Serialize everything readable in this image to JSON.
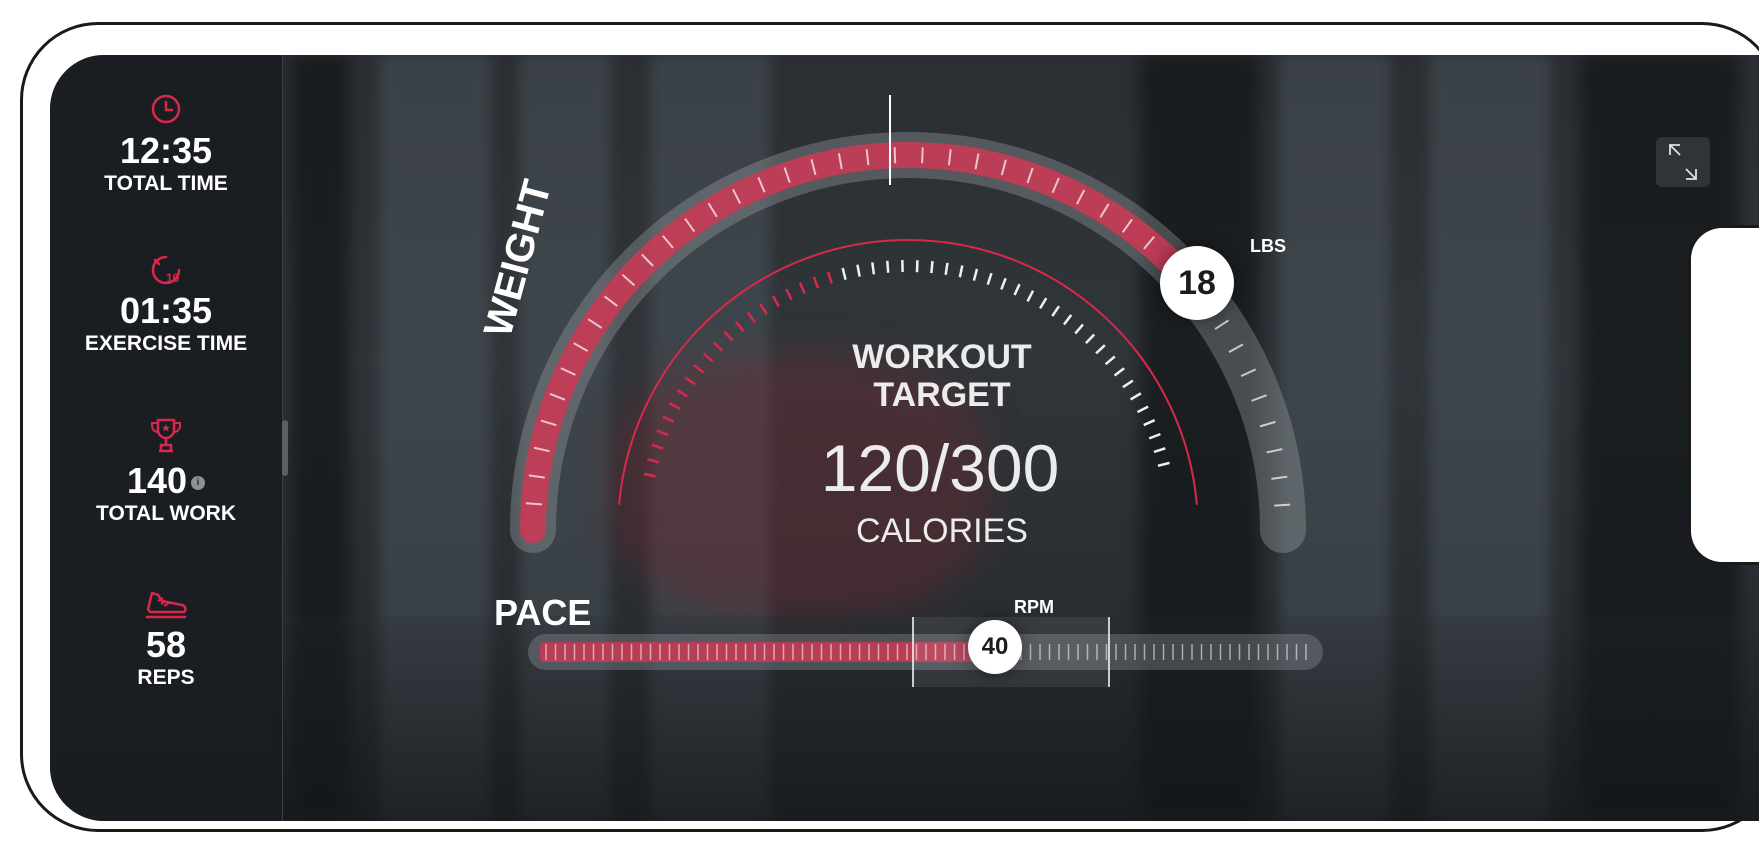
{
  "stats": {
    "total_time": {
      "value": "12:35",
      "label": "TOTAL TIME",
      "icon": "clock-icon"
    },
    "exercise_time": {
      "value": "01:35",
      "label": "EXERCISE TIME",
      "icon": "timer-10-icon"
    },
    "total_work": {
      "value": "140",
      "label": "TOTAL WORK",
      "icon": "trophy-icon",
      "info_icon": "info-icon"
    },
    "reps": {
      "value": "58",
      "label": "REPS",
      "icon": "sneaker-icon"
    }
  },
  "workout_target": {
    "title_line1": "WORKOUT",
    "title_line2": "TARGET",
    "value": "120/300",
    "unit": "CALORIES",
    "progress": 0.4
  },
  "weight": {
    "label": "WEIGHT",
    "value": "18",
    "unit": "LBS",
    "fill_fraction": 0.78
  },
  "pace": {
    "label": "PACE",
    "value": "40",
    "unit": "RPM",
    "fill_fraction": 0.61
  },
  "controls": {
    "minimize_icon": "minimize-icon"
  },
  "colors": {
    "accent": "#d8294a",
    "accent_fill": "#c83a55",
    "sidebar_bg": "#1a1d21",
    "text": "#ffffff"
  }
}
